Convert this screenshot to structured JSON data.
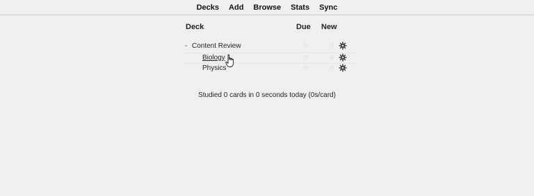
{
  "toolbar": {
    "items": [
      {
        "label": "Decks"
      },
      {
        "label": "Add"
      },
      {
        "label": "Browse"
      },
      {
        "label": "Stats"
      },
      {
        "label": "Sync"
      }
    ]
  },
  "table": {
    "headers": {
      "deck": "Deck",
      "due": "Due",
      "new": "New"
    },
    "rows": [
      {
        "name": "Content Review",
        "collapse": "-",
        "due": "0",
        "new": "0",
        "gear_icon": "gear-icon"
      },
      {
        "name": "Biology",
        "due": "0",
        "new": "0",
        "gear_icon": "gear-icon"
      },
      {
        "name": "Physics",
        "due": "0",
        "new": "0",
        "gear_icon": "gear-icon"
      }
    ]
  },
  "summary": "Studied 0 cards in 0 seconds today (0s/card)",
  "cursor": "hand-pointer-icon"
}
